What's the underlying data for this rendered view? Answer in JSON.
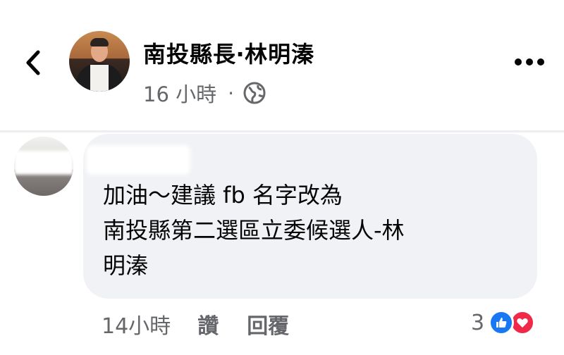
{
  "header": {
    "back_icon": "chevron-left-icon",
    "page_name": "南投縣長‧林明溱",
    "time": "16 小時",
    "separator": "·",
    "privacy_icon": "globe-icon",
    "more_icon": "more-horizontal-icon"
  },
  "comment": {
    "text": "加油～建議 fb 名字改為\n南投縣第二選區立委候選人-林\n明溱",
    "time": "14小時",
    "like_label": "讚",
    "reply_label": "回覆",
    "reaction_count": "3",
    "reactions": [
      "like-reaction-icon",
      "love-reaction-icon"
    ]
  },
  "colors": {
    "bubble": "#f0f2f5",
    "meta_text": "#65676b",
    "like_blue": "#1877f2",
    "love_red": "#f02849"
  }
}
